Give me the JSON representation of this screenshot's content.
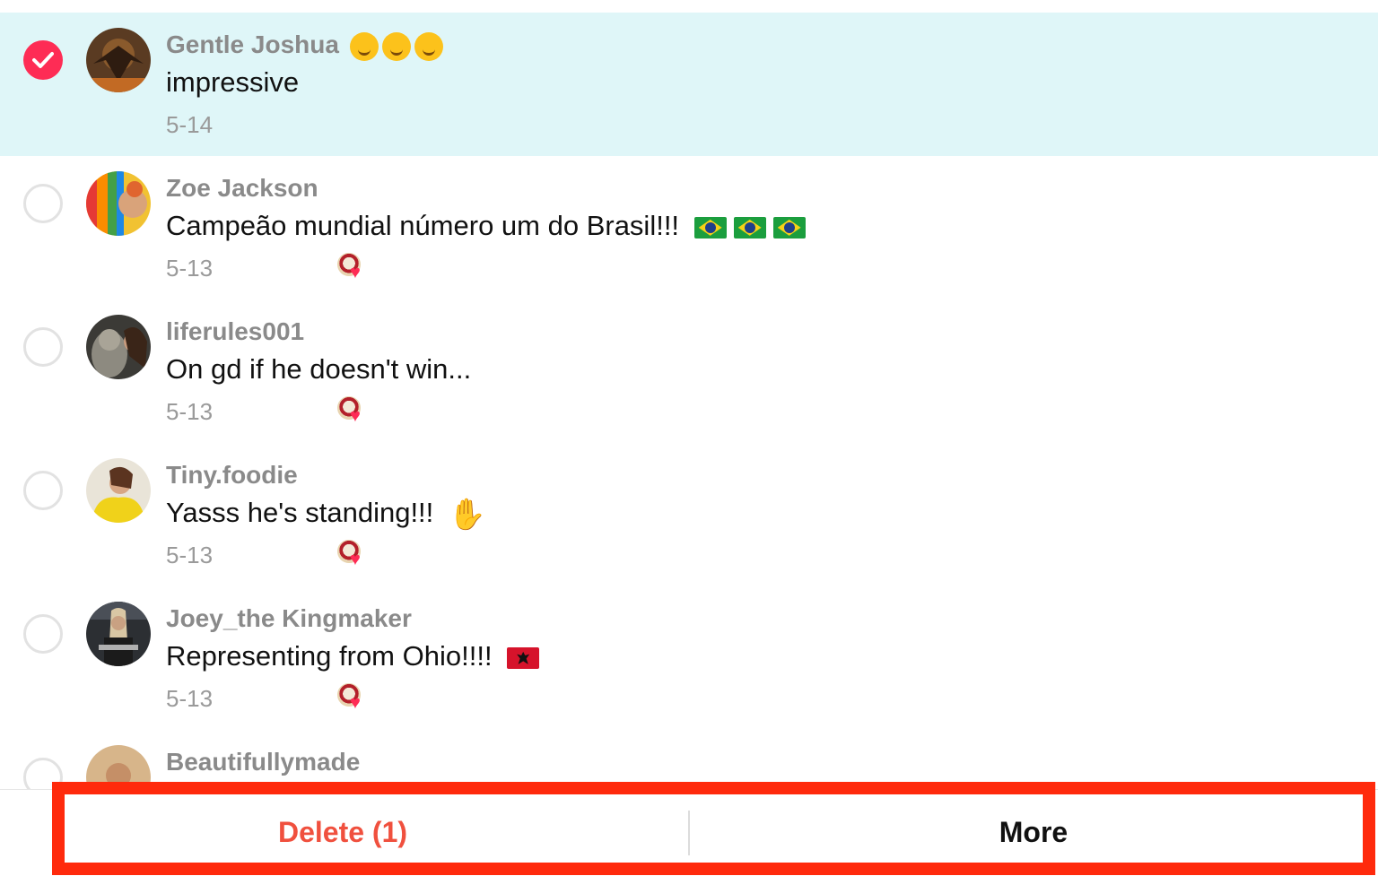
{
  "comments": [
    {
      "name": "Gentle Joshua",
      "text": "impressive",
      "date": "5-14",
      "selected": true,
      "liked_by_creator": false
    },
    {
      "name": "Zoe Jackson",
      "text": "Campeão mundial número um do Brasil!!!",
      "date": "5-13",
      "selected": false,
      "liked_by_creator": true
    },
    {
      "name": "liferules001",
      "text": "On gd if he doesn't win...",
      "date": "5-13",
      "selected": false,
      "liked_by_creator": true
    },
    {
      "name": "Tiny.foodie",
      "text": "Yasss he's standing!!!",
      "date": "5-13",
      "selected": false,
      "liked_by_creator": true
    },
    {
      "name": "Joey_the Kingmaker",
      "text": "Representing from Ohio!!!!",
      "date": "5-13",
      "selected": false,
      "liked_by_creator": true
    },
    {
      "name": "Beautifullymade",
      "text": "",
      "date": "",
      "selected": false,
      "liked_by_creator": false
    }
  ],
  "actions": {
    "delete_label": "Delete (1)",
    "more_label": "More"
  },
  "colors": {
    "accent": "#fe2c55",
    "delete_text": "#f0503e",
    "selected_row_bg": "#dff6f8",
    "highlight_border": "#ff2a0c"
  },
  "icons": [
    "check-icon",
    "brazil-flag-icon",
    "albania-flag-icon",
    "pray-emoji-icon",
    "hug-emoji-icon",
    "heart-icon"
  ]
}
